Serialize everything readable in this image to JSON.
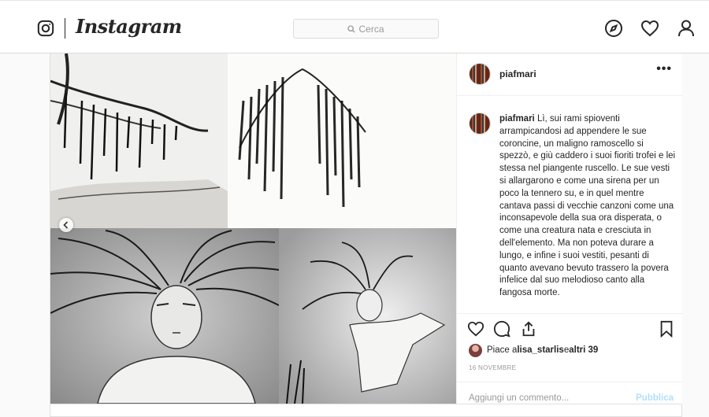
{
  "nav": {
    "brand": "Instagram",
    "search_placeholder": "Cerca",
    "icons": [
      "instagram-logo-icon",
      "search-icon",
      "compass-icon",
      "heart-icon",
      "profile-icon"
    ]
  },
  "post": {
    "author": "piafmari",
    "more_label": "•••",
    "caption_author": "piafmari",
    "caption_text": "Lì, sui rami spioventi arrampicandosi ad appendere le sue coroncine, un maligno ramoscello si spezzò, e giù caddero i suoi fioriti trofei e lei stessa nel piangente ruscello. Le sue vesti si allargarono e come una sirena per un poco la tennero su, e in quel mentre cantava passi di vecchie canzoni come una inconsapevole della sua ora disperata, o come una creatura nata e cresciuta in dell'elemento. Ma non poteva durare a lungo, e infine i suoi vestiti, pesanti di quanto avevano bevuto trassero la povera infelice dal suo melodioso canto alla fangosa morte.",
    "likes_prefix": "Piace a ",
    "likes_user": "lisa_starlis",
    "likes_middle": " e ",
    "likes_others": "altri 39",
    "date": "16 NOVEMBRE",
    "comment_placeholder": "Aggiungi un commento...",
    "publish_label": "Pubblica",
    "action_icons": [
      "heart-icon",
      "comment-icon",
      "share-icon",
      "bookmark-icon"
    ]
  },
  "colors": {
    "border": "#dbdbdb",
    "text": "#262626",
    "muted": "#999999",
    "publish_disabled": "#b2dffc"
  }
}
